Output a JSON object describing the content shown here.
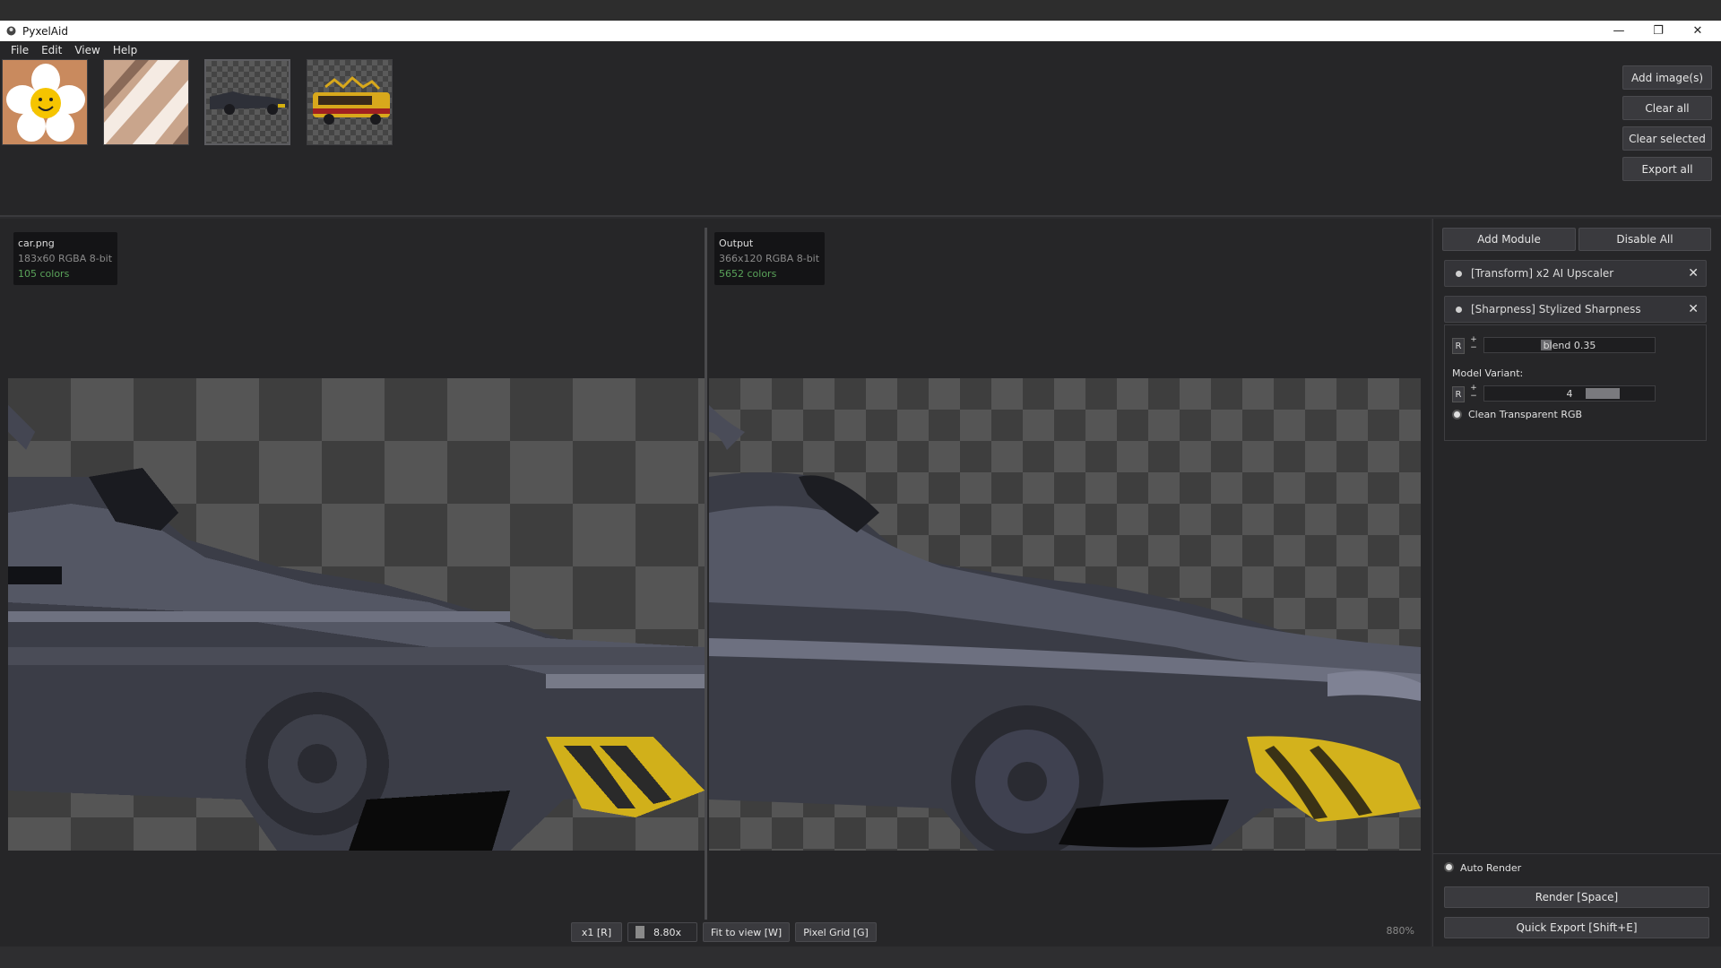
{
  "window": {
    "title": "PyxelAid"
  },
  "menu": [
    "File",
    "Edit",
    "View",
    "Help"
  ],
  "thumbnails": [
    {
      "name": "flower"
    },
    {
      "name": "stripes"
    },
    {
      "name": "car"
    },
    {
      "name": "bus"
    }
  ],
  "image_actions": {
    "add": "Add image(s)",
    "clear_all": "Clear all",
    "clear_selected": "Clear selected",
    "export_all": "Export all"
  },
  "input_info": {
    "name": "car.png",
    "meta": "183x60  RGBA  8-bit",
    "colors": "105 colors"
  },
  "output_info": {
    "name": "Output",
    "meta": "366x120  RGBA  8-bit",
    "colors": "5652 colors"
  },
  "bottom": {
    "scale_btn": "x1 [R]",
    "zoom_value": "8.80x",
    "fit_btn": "Fit to view [W]",
    "grid_btn": "Pixel Grid [G]",
    "zoom_pct": "880%"
  },
  "right_panel": {
    "add_module": "Add Module",
    "disable_all": "Disable All",
    "modules": [
      {
        "label": "[Transform] x2 AI Upscaler"
      },
      {
        "label": "[Sharpness] Stylized Sharpness"
      }
    ],
    "blend_slider": "blend 0.35",
    "blend_value": 0.35,
    "reset_label": "R",
    "plus": "+",
    "minus": "−",
    "model_variant_label": "Model Variant:",
    "model_variant_value": "4",
    "clean_rgb_label": "Clean Transparent RGB",
    "auto_render_label": "Auto Render",
    "render_btn": "Render  [Space]",
    "quick_export_btn": "Quick Export  [Shift+E]"
  },
  "colors": {
    "accent_green": "#5aa35a",
    "bg": "#262628",
    "panel": "#343438"
  }
}
